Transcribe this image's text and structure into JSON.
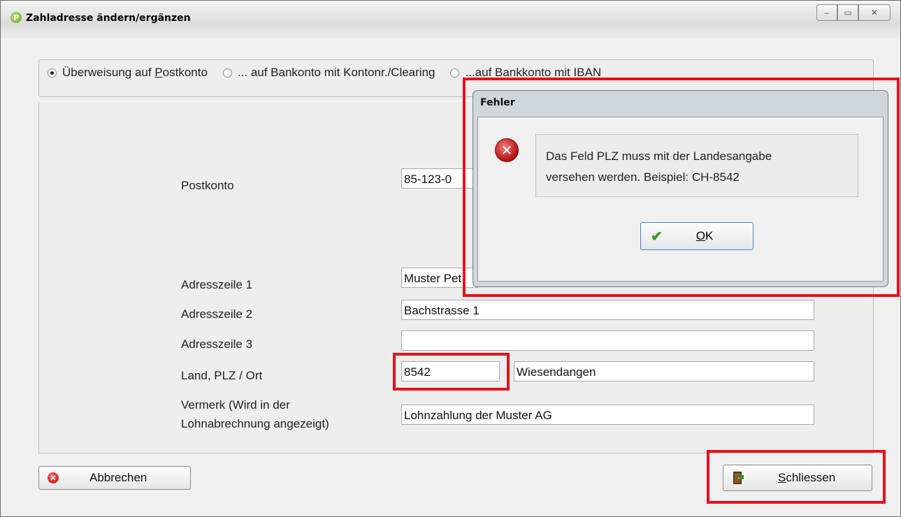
{
  "window": {
    "title": "Zahladresse ändern/ergänzen",
    "app_icon_glyph": "P",
    "controls": {
      "minimize": "–",
      "maximize": "▭",
      "close": "✕"
    }
  },
  "payment_type": {
    "options": [
      {
        "label": "Überweisung auf Postkonto",
        "checked": true
      },
      {
        "label": "... auf Bankonto mit Kontonr./Clearing",
        "checked": false
      },
      {
        "label": "...auf Bankkonto mit IBAN",
        "checked": false
      }
    ]
  },
  "form": {
    "postkonto": {
      "label": "Postkonto",
      "value": "85-123-0"
    },
    "adresszeile1": {
      "label": "Adresszeile 1",
      "value": "Muster Pet"
    },
    "adresszeile2": {
      "label": "Adresszeile 2",
      "value": "Bachstrasse 1"
    },
    "adresszeile3": {
      "label": "Adresszeile 3",
      "value": ""
    },
    "plz_ort": {
      "label": "Land, PLZ / Ort",
      "plz_value": "8542",
      "ort_value": "Wiesendangen"
    },
    "vermerk": {
      "label_line1": "Vermerk (Wird in der",
      "label_line2": "Lohnabrechnung angezeigt)",
      "value": "Lohnzahlung der Muster AG"
    }
  },
  "buttons": {
    "cancel": "Abbrechen",
    "close_first": "S",
    "close_rest": "chliessen"
  },
  "error_dialog": {
    "title": "Fehler",
    "message_line1": "Das Feld PLZ muss mit der Landesangabe",
    "message_line2": "versehen werden. Beispiel: CH-8542",
    "ok_first": "O",
    "ok_rest": "K",
    "icon": "error-icon"
  },
  "colors": {
    "highlight": "#e8101b",
    "ok_check": "#3c9a1c",
    "dialog_frame": "#cfd6dc"
  }
}
